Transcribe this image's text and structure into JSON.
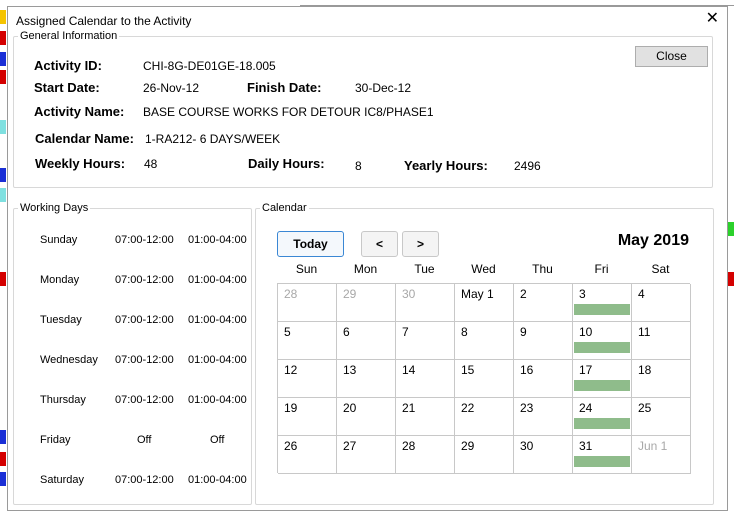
{
  "dialog": {
    "title": "Assigned Calendar to the Activity",
    "close_glyph": "✕",
    "close_button": "Close"
  },
  "general": {
    "legend": "General Information",
    "activity_id_label": "Activity ID:",
    "activity_id": "CHI-8G-DE01GE-18.005",
    "start_label": "Start Date:",
    "start_date": "26-Nov-12",
    "finish_label": "Finish Date:",
    "finish_date": "30-Dec-12",
    "name_label": "Activity Name:",
    "activity_name": "BASE COURSE WORKS FOR DETOUR IC8/PHASE1",
    "calendar_label": "Calendar Name:",
    "calendar_name": "1-RA212- 6 DAYS/WEEK",
    "weekly_label": "Weekly Hours:",
    "weekly_hours": "48",
    "daily_label": "Daily Hours:",
    "daily_hours": "8",
    "yearly_label": "Yearly Hours:",
    "yearly_hours": "2496"
  },
  "working_days": {
    "legend": "Working Days",
    "days": [
      {
        "name": "Sunday",
        "t1": "07:00-12:00",
        "t2": "01:00-04:00"
      },
      {
        "name": "Monday",
        "t1": "07:00-12:00",
        "t2": "01:00-04:00"
      },
      {
        "name": "Tuesday",
        "t1": "07:00-12:00",
        "t2": "01:00-04:00"
      },
      {
        "name": "Wednesday",
        "t1": "07:00-12:00",
        "t2": "01:00-04:00"
      },
      {
        "name": "Thursday",
        "t1": "07:00-12:00",
        "t2": "01:00-04:00"
      },
      {
        "name": "Friday",
        "t1": "Off",
        "t2": "Off"
      },
      {
        "name": "Saturday",
        "t1": "07:00-12:00",
        "t2": "01:00-04:00"
      }
    ]
  },
  "calendar": {
    "legend": "Calendar",
    "today_label": "Today",
    "prev_label": "<",
    "next_label": ">",
    "month_title": "May 2019",
    "weekdays": [
      "Sun",
      "Mon",
      "Tue",
      "Wed",
      "Thu",
      "Fri",
      "Sat"
    ],
    "event_color": "#8fbc8b",
    "weeks": [
      [
        {
          "d": "28",
          "other": true
        },
        {
          "d": "29",
          "other": true
        },
        {
          "d": "30",
          "other": true
        },
        {
          "d": "May 1"
        },
        {
          "d": "2"
        },
        {
          "d": "3",
          "off": true
        },
        {
          "d": "4"
        }
      ],
      [
        {
          "d": "5"
        },
        {
          "d": "6"
        },
        {
          "d": "7"
        },
        {
          "d": "8"
        },
        {
          "d": "9"
        },
        {
          "d": "10",
          "off": true
        },
        {
          "d": "11"
        }
      ],
      [
        {
          "d": "12"
        },
        {
          "d": "13"
        },
        {
          "d": "14"
        },
        {
          "d": "15"
        },
        {
          "d": "16"
        },
        {
          "d": "17",
          "off": true
        },
        {
          "d": "18"
        }
      ],
      [
        {
          "d": "19"
        },
        {
          "d": "20"
        },
        {
          "d": "21"
        },
        {
          "d": "22"
        },
        {
          "d": "23"
        },
        {
          "d": "24",
          "off": true
        },
        {
          "d": "25"
        }
      ],
      [
        {
          "d": "26"
        },
        {
          "d": "27"
        },
        {
          "d": "28"
        },
        {
          "d": "29"
        },
        {
          "d": "30"
        },
        {
          "d": "31",
          "off": true
        },
        {
          "d": "Jun 1",
          "other": true
        }
      ]
    ]
  },
  "background": {
    "left_marks": [
      {
        "color": "#f5c400"
      },
      {
        "color": "#d40000"
      },
      {
        "color": "#1a2fd6"
      },
      {
        "color": "#d40000"
      },
      {
        "color": "#7fe0e0"
      },
      {
        "color": "#1a2fd6"
      },
      {
        "color": "#7fe0e0"
      },
      {
        "color": "#d40000"
      },
      {
        "color": "#1a2fd6"
      },
      {
        "color": "#d40000"
      },
      {
        "color": "#1a2fd6"
      }
    ]
  }
}
